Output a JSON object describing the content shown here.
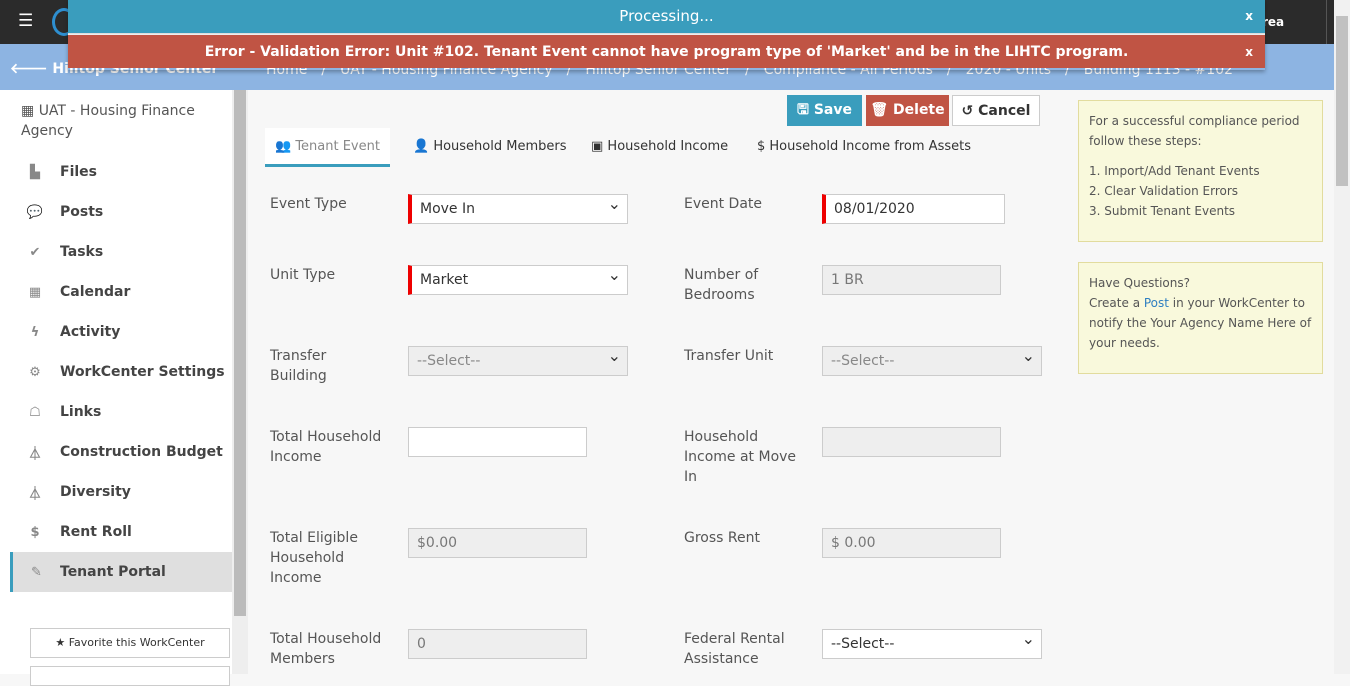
{
  "topbar": {
    "menu_icon": "hamburger-icon",
    "user_label": "rea"
  },
  "dialog": {
    "processing": "Processing...",
    "error": "Error - Validation Error: Unit #102. Tenant Event cannot have program type of 'Market' and be in the LIHTC program.",
    "close": "x"
  },
  "back": {
    "label": "Hilltop Senior Center"
  },
  "breadcrumb": [
    "Home",
    "UAT - Housing Finance Agency",
    "Hilltop Senior Center",
    "Compliance - All Periods",
    "2020 - Units",
    "Building 1113 - #102"
  ],
  "sidebar": {
    "agency": "UAT - Housing Finance Agency",
    "items": [
      {
        "label": "Files",
        "icon": "file-icon",
        "glyph": "▙"
      },
      {
        "label": "Posts",
        "icon": "comments-icon",
        "glyph": "💬"
      },
      {
        "label": "Tasks",
        "icon": "check-icon",
        "glyph": "✔"
      },
      {
        "label": "Calendar",
        "icon": "calendar-icon",
        "glyph": "▦"
      },
      {
        "label": "Activity",
        "icon": "bolt-icon",
        "glyph": "ϟ"
      },
      {
        "label": "WorkCenter Settings",
        "icon": "gear-icon",
        "glyph": "⚙"
      },
      {
        "label": "Links",
        "icon": "sitemap-icon",
        "glyph": "☖"
      },
      {
        "label": "Construction Budget",
        "icon": "flask-icon",
        "glyph": "⏃"
      },
      {
        "label": "Diversity",
        "icon": "flask-icon",
        "glyph": "⏃"
      },
      {
        "label": "Rent Roll",
        "icon": "dollar-icon",
        "glyph": "$"
      },
      {
        "label": "Tenant Portal",
        "icon": "pencil-icon",
        "glyph": "✎",
        "active": true
      }
    ],
    "favorite": "★ Favorite this WorkCenter"
  },
  "toolbar": {
    "save": "🖫 Save",
    "delete": "🗑 Delete",
    "cancel": "↺ Cancel",
    "colors": {
      "save": "#3a9dbd",
      "delete": "#c05444"
    }
  },
  "tabs": [
    {
      "label": "👥 Tenant Event",
      "active": true
    },
    {
      "label": "👤 Household Members"
    },
    {
      "label": "▣ Household Income"
    },
    {
      "label": "$ Household Income from Assets"
    }
  ],
  "form": {
    "event_type": {
      "label": "Event Type",
      "value": "Move In"
    },
    "event_date": {
      "label": "Event Date",
      "value": "08/01/2020"
    },
    "unit_type": {
      "label": "Unit Type",
      "value": "Market"
    },
    "bedrooms": {
      "label": "Number of Bedrooms",
      "value": "1 BR"
    },
    "transfer_building": {
      "label": "Transfer Building",
      "value": "--Select--"
    },
    "transfer_unit": {
      "label": "Transfer Unit",
      "value": "--Select--"
    },
    "total_income": {
      "label": "Total Household Income",
      "value": ""
    },
    "income_move_in": {
      "label": "Household Income at Move In",
      "value": ""
    },
    "eligible_income": {
      "label": "Total Eligible Household Income",
      "value": "$0.00"
    },
    "gross_rent": {
      "label": "Gross Rent",
      "value": "$ 0.00"
    },
    "members": {
      "label": "Total Household Members",
      "value": "0"
    },
    "federal_assistance": {
      "label": "Federal Rental Assistance",
      "value": "--Select--"
    }
  },
  "help": {
    "intro": "For a successful compliance period follow these steps:",
    "steps": [
      "1. Import/Add Tenant Events",
      "2. Clear Validation Errors",
      "3. Submit Tenant Events"
    ],
    "q_title": "Have Questions?",
    "q_pre": "Create a ",
    "q_link": "Post",
    "q_post": " in your WorkCenter to notify the Your Agency Name Here of your needs."
  }
}
